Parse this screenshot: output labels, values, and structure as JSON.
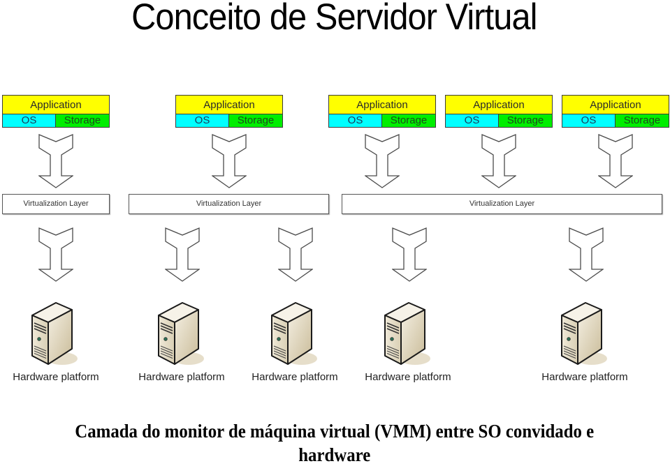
{
  "title": "Conceito de Servidor Virtual",
  "virtual_machines": [
    {
      "application": "Application",
      "os": "OS",
      "storage": "Storage"
    },
    {
      "application": "Application",
      "os": "OS",
      "storage": "Storage"
    },
    {
      "application": "Application",
      "os": "OS",
      "storage": "Storage"
    },
    {
      "application": "Application",
      "os": "OS",
      "storage": "Storage"
    },
    {
      "application": "Application",
      "os": "OS",
      "storage": "Storage"
    }
  ],
  "virtualization_layers": [
    {
      "label": "Virtualization Layer"
    },
    {
      "label": "Virtualization Layer"
    },
    {
      "label": "Virtualization Layer"
    }
  ],
  "hardware_platforms": [
    {
      "label": "Hardware platform"
    },
    {
      "label": "Hardware platform"
    },
    {
      "label": "Hardware platform"
    },
    {
      "label": "Hardware platform"
    },
    {
      "label": "Hardware platform"
    }
  ],
  "caption": {
    "line1": "Camada do monitor de máquina virtual (VMM) entre SO convidado e",
    "line2": "hardware"
  },
  "colors": {
    "application": "#ffff00",
    "os": "#00ffff",
    "storage": "#00ee00"
  }
}
